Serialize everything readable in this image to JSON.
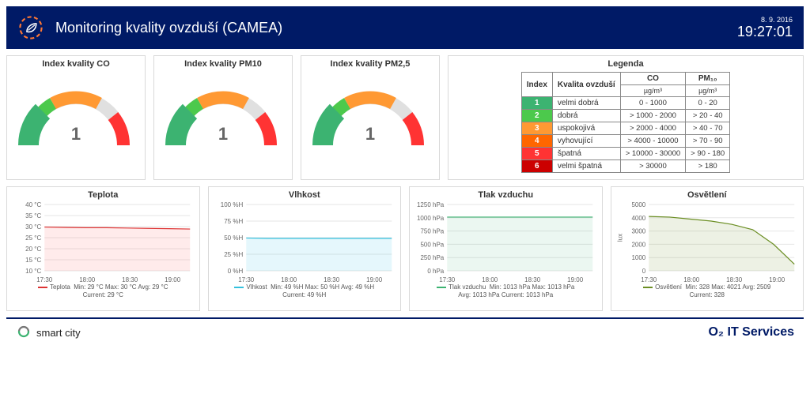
{
  "header": {
    "title": "Monitoring kvality ovzduší (CAMEA)",
    "date": "8. 9. 2016",
    "time": "19:27:01"
  },
  "gauges": [
    {
      "title": "Index kvality CO",
      "value": "1"
    },
    {
      "title": "Index kvality PM10",
      "value": "1"
    },
    {
      "title": "Index kvality PM2,5",
      "value": "1"
    }
  ],
  "legend": {
    "title": "Legenda",
    "head": {
      "index": "Index",
      "quality": "Kvalita ovzduší",
      "co": "CO",
      "pm10": "PM₁₀",
      "unit": "µg/m³"
    },
    "rows": [
      {
        "idx": "1",
        "q": "velmi dobrá",
        "co": "0 - 1000",
        "pm": "0 - 20"
      },
      {
        "idx": "2",
        "q": "dobrá",
        "co": "> 1000 - 2000",
        "pm": "> 20 - 40"
      },
      {
        "idx": "3",
        "q": "uspokojivá",
        "co": "> 2000 - 4000",
        "pm": "> 40 - 70"
      },
      {
        "idx": "4",
        "q": "vyhovující",
        "co": "> 4000 - 10000",
        "pm": "> 70 - 90"
      },
      {
        "idx": "5",
        "q": "špatná",
        "co": "> 10000 - 30000",
        "pm": "> 90 - 180"
      },
      {
        "idx": "6",
        "q": "velmi špatná",
        "co": "> 30000",
        "pm": "> 180"
      }
    ]
  },
  "chart_data": [
    {
      "type": "line",
      "title": "Teplota",
      "color": "red",
      "x_ticks": [
        "17:30",
        "18:00",
        "18:30",
        "19:00"
      ],
      "y_ticks": [
        "10 °C",
        "15 °C",
        "20 °C",
        "25 °C",
        "30 °C",
        "35 °C",
        "40 °C"
      ],
      "ylim": [
        10,
        40
      ],
      "series_name": "Teplota",
      "stats": "Min: 29 °C  Max: 30 °C  Avg: 29 °C",
      "current": "Current: 29 °C",
      "values_y_frac": [
        0.66,
        0.655,
        0.65,
        0.65,
        0.645,
        0.64,
        0.635,
        0.63
      ]
    },
    {
      "type": "line",
      "title": "Vlhkost",
      "color": "blue",
      "x_ticks": [
        "17:30",
        "18:00",
        "18:30",
        "19:00"
      ],
      "y_ticks": [
        "0 %H",
        "25 %H",
        "50 %H",
        "75 %H",
        "100 %H"
      ],
      "ylim": [
        0,
        100
      ],
      "series_name": "Vlhkost",
      "stats": "Min: 49 %H  Max: 50 %H  Avg: 49 %H",
      "current": "Current: 49 %H",
      "values_y_frac": [
        0.495,
        0.49,
        0.49,
        0.49,
        0.49,
        0.49,
        0.49,
        0.49
      ]
    },
    {
      "type": "line",
      "title": "Tlak vzduchu",
      "color": "green",
      "x_ticks": [
        "17:30",
        "18:00",
        "18:30",
        "19:00"
      ],
      "y_ticks": [
        "0 hPa",
        "250 hPa",
        "500 hPa",
        "750 hPa",
        "1000 hPa",
        "1250 hPa"
      ],
      "ylim": [
        0,
        1250
      ],
      "series_name": "Tlak vzduchu",
      "stats": "Min: 1013 hPa  Max: 1013 hPa",
      "current": "Avg: 1013 hPa  Current: 1013 hPa",
      "values_y_frac": [
        0.81,
        0.81,
        0.81,
        0.81,
        0.81,
        0.81,
        0.81,
        0.81
      ]
    },
    {
      "type": "line",
      "title": "Osvětlení",
      "color": "olive",
      "x_ticks": [
        "17:30",
        "18:00",
        "18:30",
        "19:00"
      ],
      "y_ticks": [
        "0",
        "1000",
        "2000",
        "3000",
        "4000",
        "5000"
      ],
      "ylim": [
        0,
        5000
      ],
      "series_name": "Osvětlení",
      "ylabel": "lux",
      "stats": "Min: 328  Max: 4021  Avg: 2509",
      "current": "Current: 328",
      "values_y_frac": [
        0.82,
        0.81,
        0.78,
        0.75,
        0.7,
        0.62,
        0.4,
        0.1
      ]
    }
  ],
  "footer": {
    "left": "smart city",
    "right_brand": "O₂",
    "right_text": " IT Services"
  }
}
